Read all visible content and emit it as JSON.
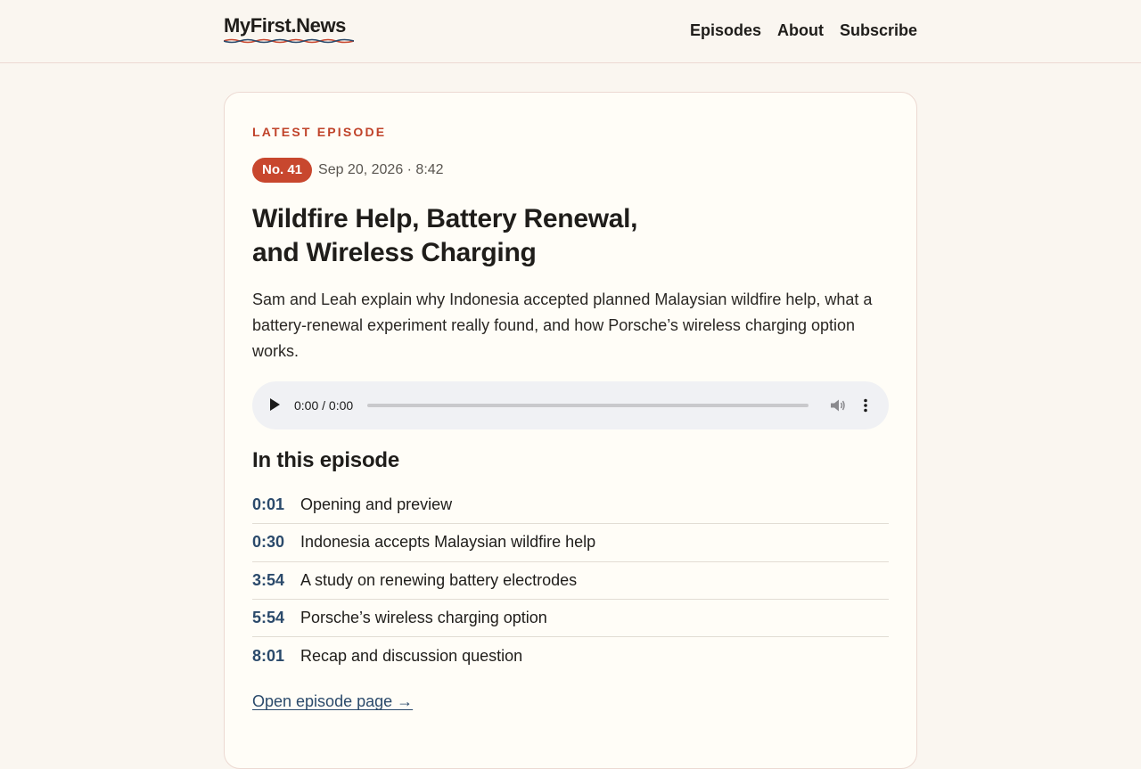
{
  "site": {
    "logo": "MyFirst.News",
    "nav": [
      "Episodes",
      "About",
      "Subscribe"
    ]
  },
  "episode": {
    "eyebrow": "LATEST EPISODE",
    "badge": "No. 41",
    "meta": "Sep 20, 2026 · 8:42",
    "title": "Wildfire Help, Battery Renewal, and Wireless Charging",
    "description": "Sam and Leah explain why Indonesia accepted planned Malaysian wildfire help, what a battery-renewal experiment really found, and how Porsche’s wireless charging option works.",
    "player": {
      "time": "0:00 / 0:00",
      "progress": 0,
      "icons": [
        "play-icon",
        "volume-icon",
        "more-vertical-icon"
      ]
    },
    "chapters_heading": "In this episode",
    "chapters": [
      {
        "time": "0:01",
        "label": "Opening and preview"
      },
      {
        "time": "0:30",
        "label": "Indonesia accepts Malaysian wildfire help"
      },
      {
        "time": "3:54",
        "label": "A study on renewing battery electrodes"
      },
      {
        "time": "5:54",
        "label": "Porsche’s wireless charging option"
      },
      {
        "time": "8:01",
        "label": "Recap and discussion question"
      }
    ],
    "open_link": "Open episode page →"
  },
  "colors": {
    "accent": "#c8472e",
    "link": "#2b4a6b",
    "background": "#faf6f0",
    "card": "#fffdf7"
  }
}
